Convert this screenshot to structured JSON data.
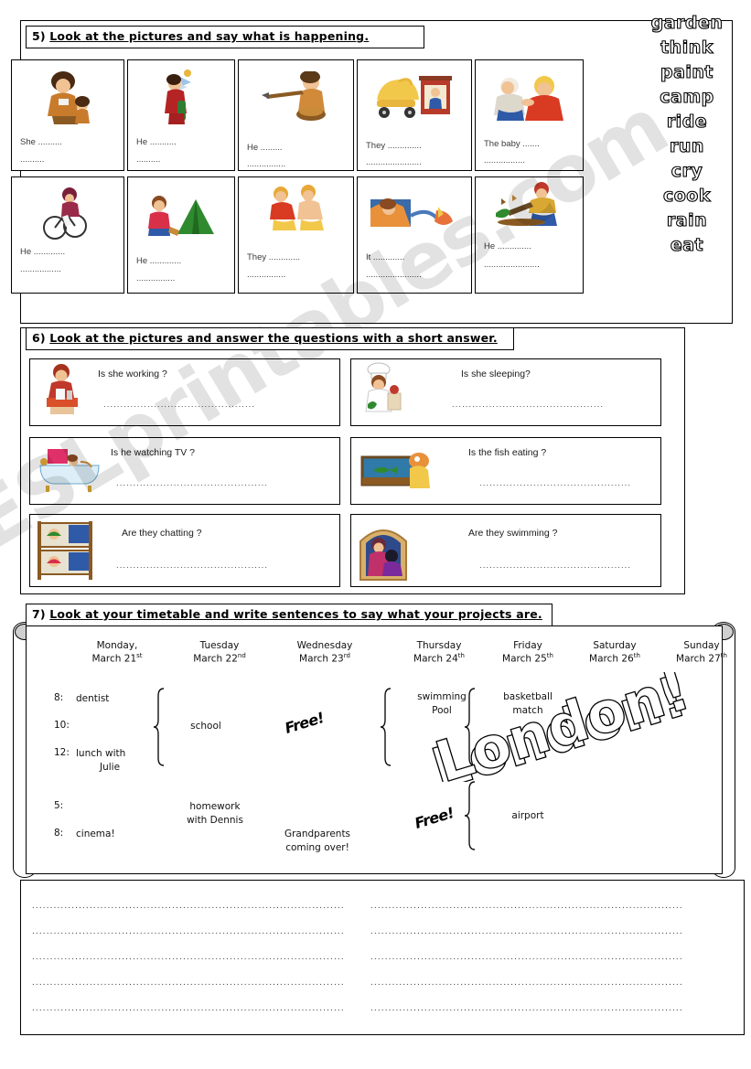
{
  "watermark": {
    "text": "ESLprintables.com"
  },
  "exercise5": {
    "number": "5)",
    "title": "Look at the pictures and say what is happening.",
    "cells": [
      {
        "icon": "cavewoman-with-child-icon",
        "line1": "She ..........",
        "line2": ".........."
      },
      {
        "icon": "man-painting-icon",
        "line1": "He ...........",
        "line2": ".........."
      },
      {
        "icon": "man-cooking-fire-icon",
        "line1": "He .........",
        "line2": "................"
      },
      {
        "icon": "baby-pram-icon",
        "line1": "They ..............",
        "line2": "......................."
      },
      {
        "icon": "baby-crying-mother-icon",
        "line1": "The baby  .......",
        "line2": "................."
      },
      {
        "icon": "cyclist-icon",
        "line1": "He  .............",
        "line2": "................."
      },
      {
        "icon": "camping-tent-icon",
        "line1": "He  .............",
        "line2": "................"
      },
      {
        "icon": "people-running-icon",
        "line1": "They  .............",
        "line2": "................"
      },
      {
        "icon": "rain-storm-icon",
        "line1": "It  .............",
        "line2": "......................."
      },
      {
        "icon": "man-gardening-icon",
        "line1": "He  ..............",
        "line2": "......................."
      }
    ],
    "wordbank": [
      "garden",
      "think",
      "paint",
      "camp",
      "ride",
      "run",
      "cry",
      "cook",
      "rain",
      "eat"
    ]
  },
  "exercise6": {
    "number": "6)",
    "title": "Look at the pictures and answer the questions with a short answer.",
    "items": [
      {
        "icon": "girl-at-desk-icon",
        "question": "Is she working ?",
        "answer_dots": "............................................."
      },
      {
        "icon": "chef-cooking-icon",
        "question": "Is she sleeping?",
        "answer_dots": "............................................."
      },
      {
        "icon": "bathtub-icon",
        "question": "Is he watching TV ?",
        "answer_dots": "............................................."
      },
      {
        "icon": "fish-tank-cat-icon",
        "question": "Is the fish eating ?",
        "answer_dots": "............................................."
      },
      {
        "icon": "bunk-beds-icon",
        "question": "Are they chatting ?",
        "answer_dots": "............................................."
      },
      {
        "icon": "couple-window-icon",
        "question": "Are they swimming ?",
        "answer_dots": "............................................."
      }
    ]
  },
  "exercise7": {
    "number": "7)",
    "title": "Look at your timetable and write sentences to say what your projects are.",
    "days": [
      {
        "name": "Monday,",
        "date": "March 21",
        "suffix": "st"
      },
      {
        "name": "Tuesday",
        "date": "March 22",
        "suffix": "nd"
      },
      {
        "name": "Wednesday",
        "date": "March 23",
        "suffix": "rd"
      },
      {
        "name": "Thursday",
        "date": "March 24",
        "suffix": "th"
      },
      {
        "name": "Friday",
        "date": "March 25",
        "suffix": "th"
      },
      {
        "name": "Saturday",
        "date": "March 26",
        "suffix": "th"
      },
      {
        "name": "Sunday",
        "date": "March 27",
        "suffix": "th"
      }
    ],
    "times": [
      "8:",
      "10:",
      "12:",
      "5:",
      "8:"
    ],
    "monday_entries": [
      "dentist",
      "",
      "lunch with\nJulie",
      "",
      "cinema!"
    ],
    "monday_8": "dentist",
    "monday_12": "lunch with",
    "monday_12b": "Julie",
    "monday_8pm": "cinema!",
    "tuesday_school": "school",
    "tuesday_homework1": "homework",
    "tuesday_homework2": "with Dennis",
    "wednesday_free": "Free!",
    "wednesday_grandparents1": "Grandparents",
    "wednesday_grandparents2": "coming over!",
    "thursday_swim1": "swimming",
    "thursday_swim2": "Pool",
    "thursday_free": "Free!",
    "friday_basket1": "basketball",
    "friday_basket2": "match",
    "friday_airport": "airport",
    "weekend_label": "London!"
  },
  "answer_area": {
    "dots_left": ".......................................................................................",
    "dots_right": "......................................................................................."
  }
}
